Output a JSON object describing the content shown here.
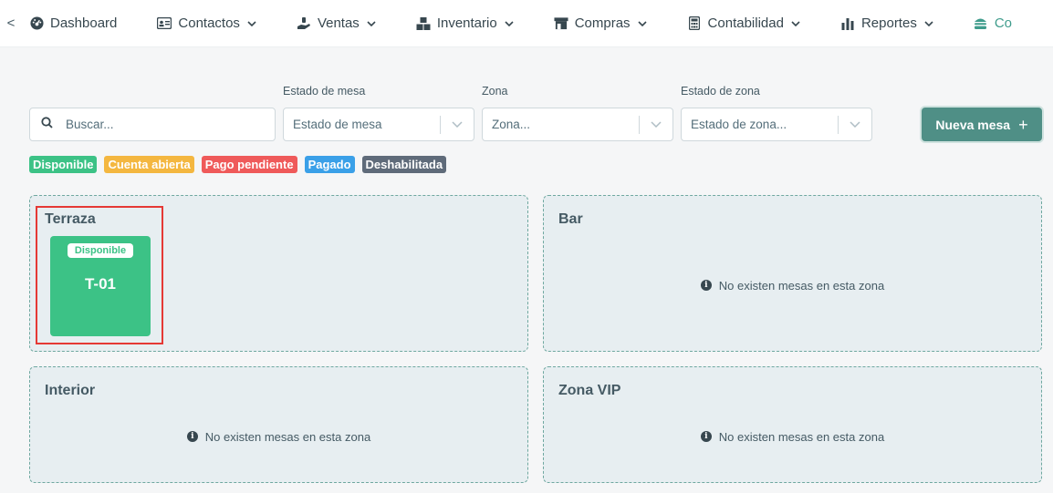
{
  "nav": {
    "back": "<",
    "items": [
      {
        "label": "Dashboard",
        "icon": "dashboard-icon",
        "dropdown": false
      },
      {
        "label": "Contactos",
        "icon": "contacts-card-icon",
        "dropdown": true
      },
      {
        "label": "Ventas",
        "icon": "sales-hand-icon",
        "dropdown": true
      },
      {
        "label": "Inventario",
        "icon": "boxes-icon",
        "dropdown": true
      },
      {
        "label": "Compras",
        "icon": "store-icon",
        "dropdown": true
      },
      {
        "label": "Contabilidad",
        "icon": "calculator-icon",
        "dropdown": true
      },
      {
        "label": "Reportes",
        "icon": "bar-chart-icon",
        "dropdown": true
      },
      {
        "label": "Co",
        "icon": "hamburger-food-icon",
        "dropdown": false
      }
    ]
  },
  "filters": {
    "search_placeholder": "Buscar...",
    "estado_mesa_label": "Estado de mesa",
    "estado_mesa_value": "Estado de mesa",
    "zona_label": "Zona",
    "zona_value": "Zona...",
    "estado_zona_label": "Estado de zona",
    "estado_zona_value": "Estado de zona..."
  },
  "new_button": {
    "label": "Nueva mesa",
    "plus": "+"
  },
  "legend": [
    {
      "label": "Disponible",
      "color": "#3cc286"
    },
    {
      "label": "Cuenta abierta",
      "color": "#f4b740"
    },
    {
      "label": "Pago pendiente",
      "color": "#ef5a5a"
    },
    {
      "label": "Pagado",
      "color": "#3aa0e8"
    },
    {
      "label": "Deshabilitada",
      "color": "#5f6b7a"
    }
  ],
  "zones": [
    {
      "title": "Terraza",
      "empty_text": ""
    },
    {
      "title": "Bar",
      "empty_text": "No existen mesas en esta zona"
    },
    {
      "title": "Interior",
      "empty_text": "No existen mesas en esta zona"
    },
    {
      "title": "Zona VIP",
      "empty_text": "No existen mesas en esta zona"
    }
  ],
  "tables": [
    {
      "name": "T-01",
      "status": "Disponible"
    }
  ],
  "info_glyph": "i",
  "colors": {
    "accent": "#4f8f86",
    "available": "#3cc286",
    "highlight": "#e53935"
  }
}
